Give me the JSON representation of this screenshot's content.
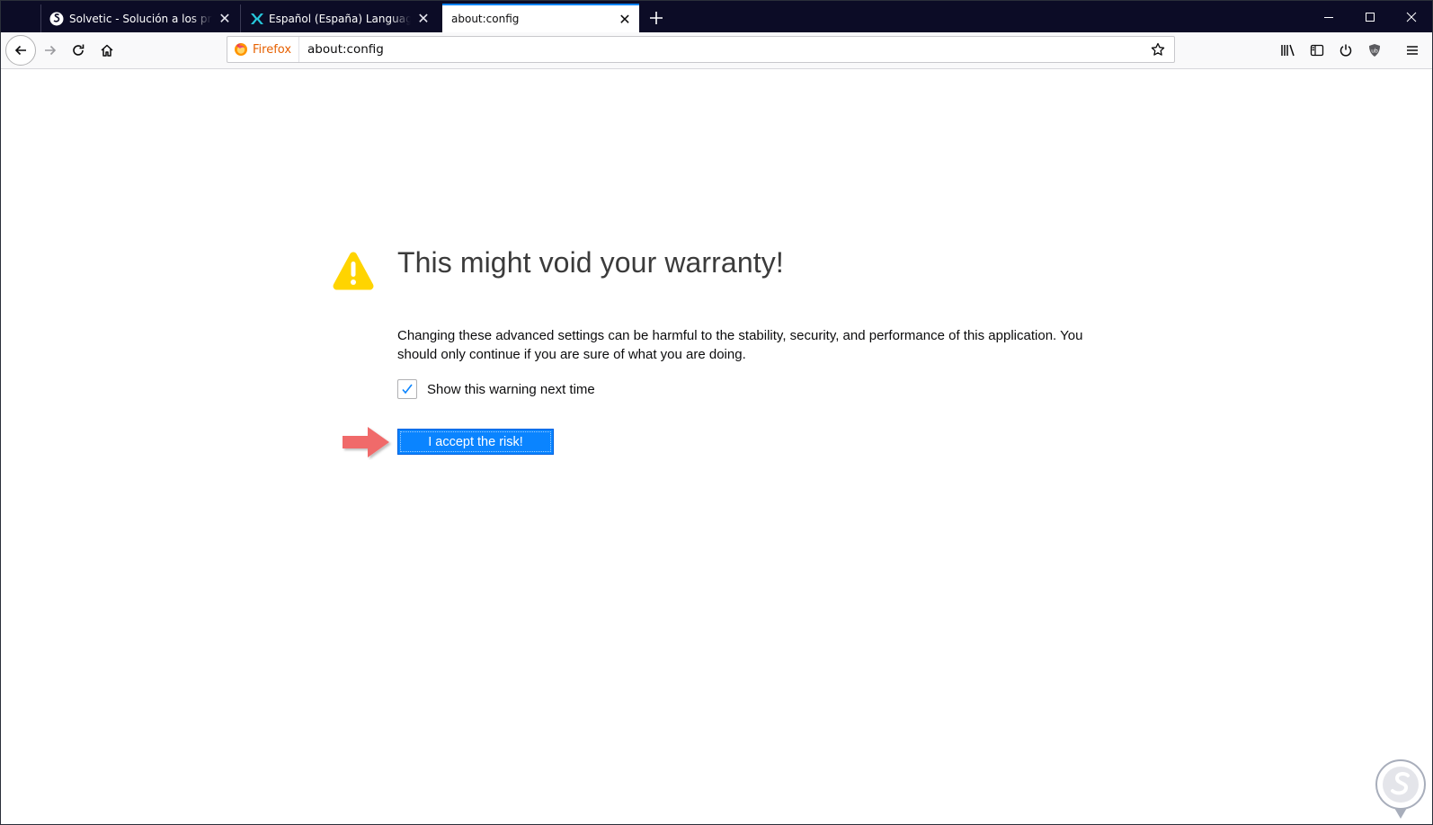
{
  "tabs": [
    {
      "title": "Solvetic - Solución a los problemas informáticos",
      "icon": "solvetic-favicon-icon",
      "active": false
    },
    {
      "title": "Español (España) Language Pack",
      "icon": "language-pack-favicon-icon",
      "active": false
    },
    {
      "title": "about:config",
      "icon": "",
      "active": true
    }
  ],
  "window_controls": [
    "minimize-icon",
    "maximize-icon",
    "close-icon"
  ],
  "navbar": {
    "identity_label": "Firefox",
    "url": "about:config",
    "buttons_left": [
      "back-icon",
      "forward-icon",
      "reload-icon",
      "home-icon"
    ],
    "buttons_right": [
      "library-icon",
      "sidebar-icon",
      "power-icon",
      "ublock-icon",
      "menu-icon"
    ]
  },
  "warning": {
    "title": "This might void your warranty!",
    "description": "Changing these advanced settings can be harmful to the stability, security, and performance of this application. You should only continue if you are sure of what you are doing.",
    "checkbox_label": "Show this warning next time",
    "checkbox_checked": true,
    "accept_label": "I accept the risk!"
  },
  "colors": {
    "tabstrip_bg": "#0c0c26",
    "accent": "#0a84ff",
    "warning_yellow": "#ffd400",
    "annotation_arrow": "#f06b6b",
    "identity_orange": "#e66000"
  }
}
